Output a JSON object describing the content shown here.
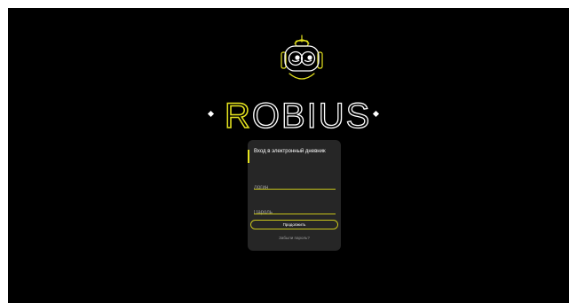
{
  "brand": {
    "name_first_letter": "R",
    "name_rest": "OBIUS"
  },
  "login": {
    "title": "Вход в электронный дневник",
    "login_placeholder": "Логин",
    "password_placeholder": "Пароль",
    "submit_label": "Продолжить",
    "forgot_label": "Забыли пароль?"
  },
  "colors": {
    "background": "#000000",
    "card": "#262626",
    "accent": "#e5e31f"
  },
  "icons": {
    "logo": "robot-head-icon"
  }
}
